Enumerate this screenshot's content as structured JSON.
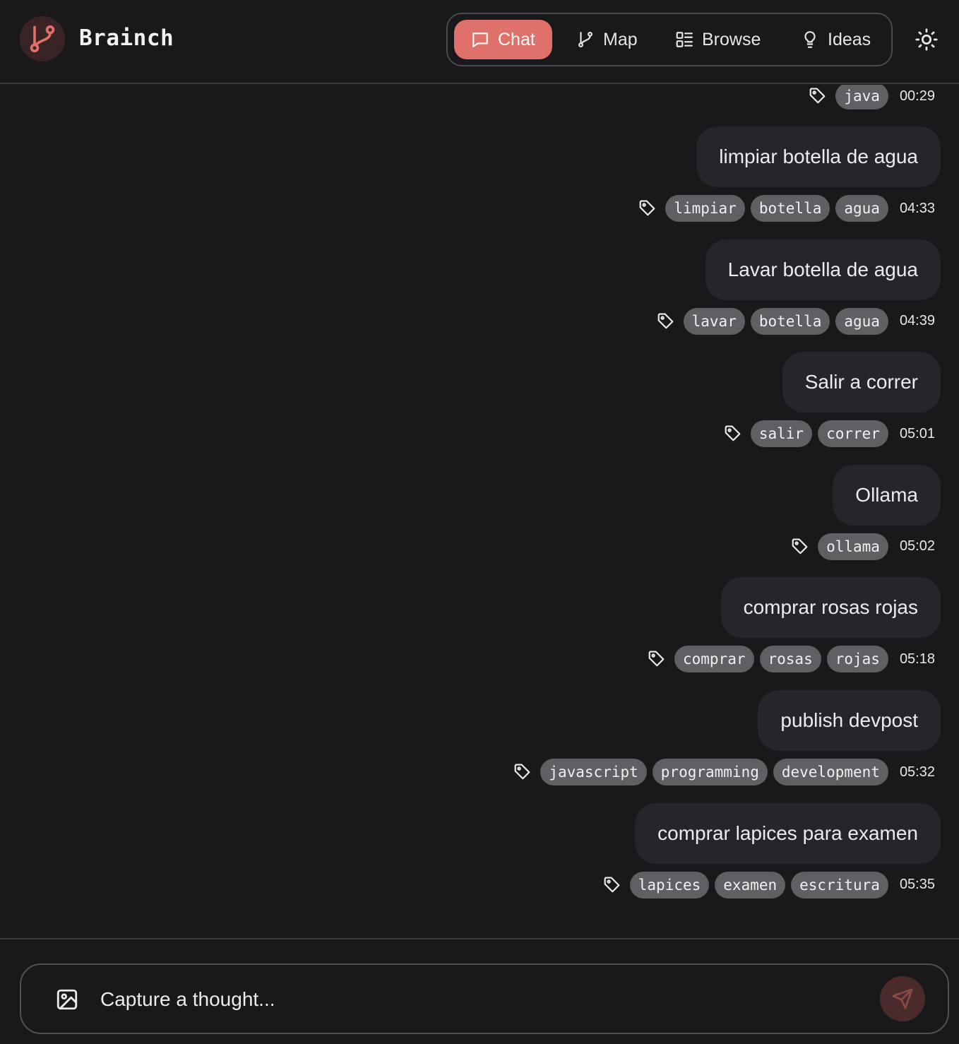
{
  "app": {
    "title": "Brainch"
  },
  "nav": {
    "chat": "Chat",
    "map": "Map",
    "browse": "Browse",
    "ideas": "Ideas",
    "active": "Chat"
  },
  "colors": {
    "accent": "#e0716a",
    "background": "#19191c",
    "bubble": "#24262c",
    "tag": "#5f5f64"
  },
  "feed": {
    "top_partial": {
      "tags": [
        "java"
      ],
      "time": "00:29"
    },
    "messages": [
      {
        "text": "limpiar botella de agua",
        "tags": [
          "limpiar",
          "botella",
          "agua"
        ],
        "time": "04:33"
      },
      {
        "text": "Lavar botella de agua",
        "tags": [
          "lavar",
          "botella",
          "agua"
        ],
        "time": "04:39"
      },
      {
        "text": "Salir a correr",
        "tags": [
          "salir",
          "correr"
        ],
        "time": "05:01"
      },
      {
        "text": "Ollama",
        "tags": [
          "ollama"
        ],
        "time": "05:02"
      },
      {
        "text": "comprar rosas rojas",
        "tags": [
          "comprar",
          "rosas",
          "rojas"
        ],
        "time": "05:18"
      },
      {
        "text": "publish devpost",
        "tags": [
          "javascript",
          "programming",
          "development"
        ],
        "time": "05:32"
      },
      {
        "text": "comprar lapices para examen",
        "tags": [
          "lapices",
          "examen",
          "escritura"
        ],
        "time": "05:35"
      }
    ]
  },
  "composer": {
    "placeholder": "Capture a thought...",
    "value": "",
    "icons": {
      "attach": "image-icon",
      "send": "send-icon"
    }
  }
}
